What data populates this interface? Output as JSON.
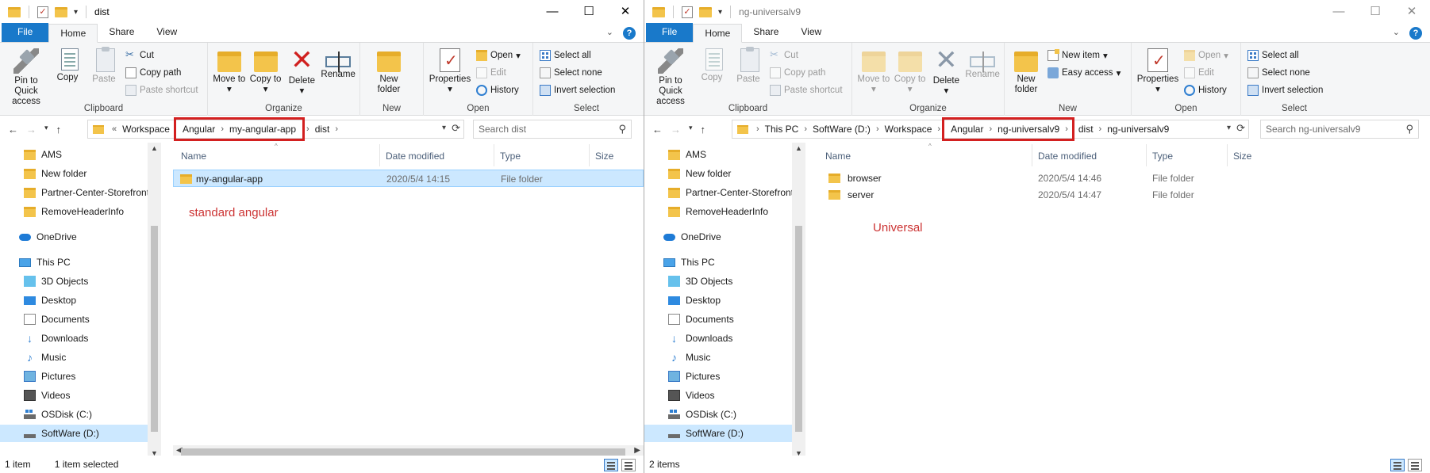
{
  "left": {
    "title": "dist",
    "ribbon_tabs": [
      "File",
      "Home",
      "Share",
      "View"
    ],
    "clipboard": {
      "pin": "Pin to Quick access",
      "copy": "Copy",
      "paste": "Paste",
      "cut": "Cut",
      "copy_path": "Copy path",
      "paste_shortcut": "Paste shortcut",
      "label": "Clipboard"
    },
    "organize": {
      "move_to": "Move to",
      "copy_to": "Copy to",
      "delete": "Delete",
      "rename": "Rename",
      "label": "Organize"
    },
    "new": {
      "new_folder": "New folder",
      "label": "New"
    },
    "open": {
      "properties": "Properties",
      "open": "Open",
      "edit": "Edit",
      "history": "History",
      "label": "Open"
    },
    "select": {
      "select_all": "Select all",
      "select_none": "Select none",
      "invert": "Invert selection",
      "label": "Select"
    },
    "address": {
      "overflow": "«",
      "crumbs_before": [
        "Workspace"
      ],
      "highlighted": [
        "Angular",
        "my-angular-app"
      ],
      "crumbs_after": [
        "dist"
      ]
    },
    "search_placeholder": "Search dist",
    "nav_items": [
      "AMS",
      "New folder",
      "Partner-Center-Storefront",
      "RemoveHeaderInfo",
      "OneDrive",
      "This PC",
      "3D Objects",
      "Desktop",
      "Documents",
      "Downloads",
      "Music",
      "Pictures",
      "Videos",
      "OSDisk (C:)",
      "SoftWare (D:)"
    ],
    "columns": [
      "Name",
      "Date modified",
      "Type",
      "Size"
    ],
    "files": [
      {
        "name": "my-angular-app",
        "date": "2020/5/4 14:15",
        "type": "File folder"
      }
    ],
    "annotation": "standard angular",
    "status_count": "1 item",
    "status_selected": "1 item selected"
  },
  "right": {
    "title": "ng-universalv9",
    "ribbon_tabs": [
      "File",
      "Home",
      "Share",
      "View"
    ],
    "clipboard": {
      "pin": "Pin to Quick access",
      "copy": "Copy",
      "paste": "Paste",
      "cut": "Cut",
      "copy_path": "Copy path",
      "paste_shortcut": "Paste shortcut",
      "label": "Clipboard"
    },
    "organize": {
      "move_to": "Move to",
      "copy_to": "Copy to",
      "delete": "Delete",
      "rename": "Rename",
      "label": "Organize"
    },
    "new": {
      "new_folder": "New folder",
      "new_item": "New item",
      "easy_access": "Easy access",
      "label": "New"
    },
    "open": {
      "properties": "Properties",
      "open": "Open",
      "edit": "Edit",
      "history": "History",
      "label": "Open"
    },
    "select": {
      "select_all": "Select all",
      "select_none": "Select none",
      "invert": "Invert selection",
      "label": "Select"
    },
    "address": {
      "crumbs_before": [
        "This PC",
        "SoftWare (D:)",
        "Workspace"
      ],
      "highlighted": [
        "Angular",
        "ng-universalv9"
      ],
      "crumbs_after": [
        "dist",
        "ng-universalv9"
      ]
    },
    "search_placeholder": "Search ng-universalv9",
    "nav_items": [
      "AMS",
      "New folder",
      "Partner-Center-Storefront",
      "RemoveHeaderInfo",
      "OneDrive",
      "This PC",
      "3D Objects",
      "Desktop",
      "Documents",
      "Downloads",
      "Music",
      "Pictures",
      "Videos",
      "OSDisk (C:)",
      "SoftWare (D:)"
    ],
    "columns": [
      "Name",
      "Date modified",
      "Type",
      "Size"
    ],
    "files": [
      {
        "name": "browser",
        "date": "2020/5/4 14:46",
        "type": "File folder"
      },
      {
        "name": "server",
        "date": "2020/5/4 14:47",
        "type": "File folder"
      }
    ],
    "annotation": "Universal",
    "status_count": "2 items"
  },
  "colors": {
    "accent": "#1979ca",
    "highlight_box": "#d32020",
    "annotation": "#cc3333",
    "selection": "#cce8ff"
  }
}
